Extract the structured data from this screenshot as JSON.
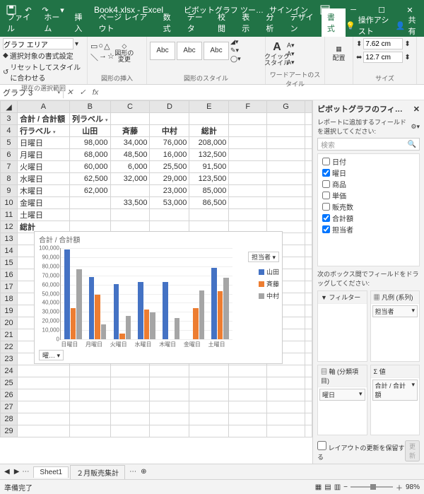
{
  "title": {
    "filename": "Book4.xlsx",
    "app": "Excel",
    "tools": "ピボットグラフ ツー…",
    "signin": "サインイン"
  },
  "tabs": [
    "ファイル",
    "ホーム",
    "挿入",
    "ページ レイアウト",
    "数式",
    "データ",
    "校閲",
    "表示",
    "分析",
    "デザイン",
    "書式"
  ],
  "tab_right": {
    "assist": "操作アシスト",
    "share": "共有"
  },
  "ribbon": {
    "group1": {
      "sel_label": "グラフ エリア",
      "fmt_sel": "選択対象の書式設定",
      "reset": "リセットしてスタイルに合わせる",
      "label": "現在の選択範囲"
    },
    "group2": {
      "change": "図形の\n変更",
      "label": "図形の挿入"
    },
    "group3": {
      "abc": "Abc",
      "label": "図形のスタイル"
    },
    "group4": {
      "quick": "クイック\nスタイル",
      "label": "ワードアートのスタイル"
    },
    "group5": {
      "align": "配置",
      "w": "7.62 cm",
      "h": "12.7 cm",
      "label": "サイズ"
    }
  },
  "namebox": "グラフ 3",
  "pivot": {
    "corner": "合計 / 合計額",
    "col_label": "列ラベル",
    "row_label": "行ラベル",
    "cols": [
      "山田",
      "斉藤",
      "中村",
      "総計"
    ],
    "rows": [
      {
        "r": "日曜日",
        "v": [
          98000,
          34000,
          76000,
          208000
        ]
      },
      {
        "r": "月曜日",
        "v": [
          68000,
          48500,
          16000,
          132500
        ]
      },
      {
        "r": "火曜日",
        "v": [
          60000,
          6000,
          25500,
          91500
        ]
      },
      {
        "r": "水曜日",
        "v": [
          62500,
          32000,
          29000,
          123500
        ]
      },
      {
        "r": "木曜日",
        "v": [
          62000,
          null,
          23000,
          85000
        ]
      },
      {
        "r": "金曜日",
        "v": [
          null,
          33500,
          53000,
          86500
        ]
      },
      {
        "r": "土曜日",
        "v": [
          null,
          null,
          null,
          null
        ]
      }
    ],
    "grand": "総計"
  },
  "chart_data": {
    "type": "bar",
    "title": "合計 / 合計額",
    "categories": [
      "日曜日",
      "月曜日",
      "火曜日",
      "水曜日",
      "木曜日",
      "金曜日",
      "土曜日"
    ],
    "series": [
      {
        "name": "山田",
        "color": "#4472C4",
        "values": [
          98000,
          68000,
          60000,
          62500,
          62000,
          0,
          78000
        ]
      },
      {
        "name": "斉藤",
        "color": "#ED7D31",
        "values": [
          34000,
          48500,
          6000,
          32000,
          0,
          33500,
          52000
        ]
      },
      {
        "name": "中村",
        "color": "#A5A5A5",
        "values": [
          76000,
          16000,
          25500,
          29000,
          23000,
          53000,
          67000
        ]
      }
    ],
    "ymax": 100000,
    "ystep": 10000,
    "legend_title": "担当者",
    "bottom_btn": "曜…"
  },
  "pane": {
    "title": "ピボットグラフのフィ…",
    "sub": "レポートに追加するフィールドを選択してください:",
    "search": "検索",
    "fields": [
      {
        "name": "日付",
        "checked": false
      },
      {
        "name": "曜日",
        "checked": true
      },
      {
        "name": "商品",
        "checked": false
      },
      {
        "name": "単価",
        "checked": false
      },
      {
        "name": "販売数",
        "checked": false
      },
      {
        "name": "合計額",
        "checked": true
      },
      {
        "name": "担当者",
        "checked": true
      }
    ],
    "drag_hint": "次のボックス間でフィールドをドラッグしてください:",
    "zones": {
      "filter": "フィルター",
      "legend": "凡例 (系列)",
      "axis": "軸 (分類項目)",
      "values": "Σ 値",
      "legend_val": "担当者",
      "axis_val": "曜日",
      "values_val": "合計 / 合計額"
    },
    "defer": "レイアウトの更新を保留する",
    "update": "更新"
  },
  "sheets": {
    "s1": "Sheet1",
    "s2": "２月販売集計"
  },
  "status": {
    "ready": "準備完了",
    "zoom": "98%"
  }
}
